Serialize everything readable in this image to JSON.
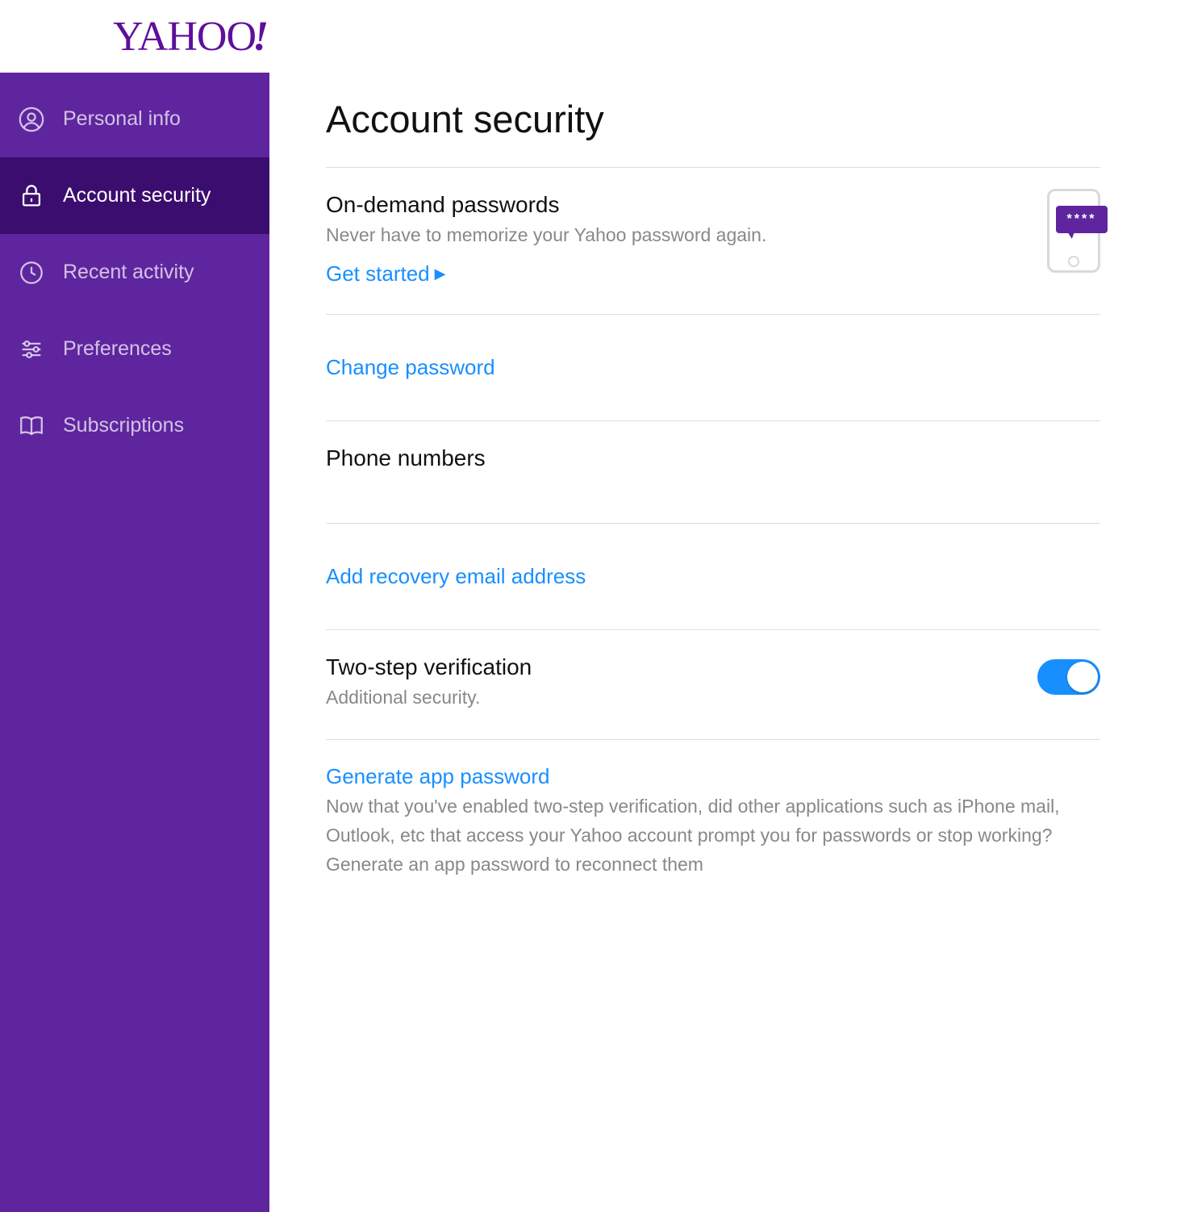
{
  "brand": "YAHOO",
  "sidebar": {
    "items": [
      {
        "label": "Personal info"
      },
      {
        "label": "Account security"
      },
      {
        "label": "Recent activity"
      },
      {
        "label": "Preferences"
      },
      {
        "label": "Subscriptions"
      }
    ]
  },
  "page": {
    "title": "Account security",
    "odp": {
      "title": "On-demand passwords",
      "sub": "Never have to memorize your Yahoo password again.",
      "cta": "Get started"
    },
    "changePw": "Change password",
    "phoneNumbers": "Phone numbers",
    "addRecovery": "Add recovery email address",
    "twoStep": {
      "title": "Two-step verification",
      "sub": "Additional security."
    },
    "appPw": {
      "link": "Generate app password",
      "desc": "Now that you've enabled two-step verification, did other applications such as iPhone mail, Outlook, etc that access your Yahoo account prompt you for passwords or stop working? Generate an app password to reconnect them"
    }
  }
}
